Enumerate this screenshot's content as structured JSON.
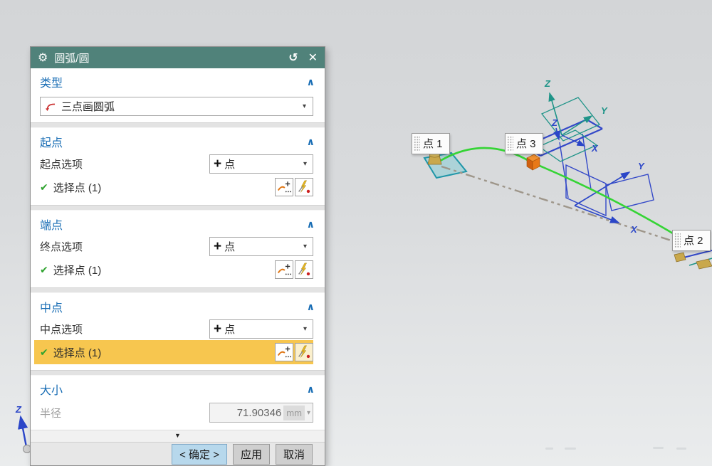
{
  "dialog": {
    "title": "圆弧/圆",
    "type_section": {
      "header": "类型",
      "value": "三点画圆弧"
    },
    "start_section": {
      "header": "起点",
      "option_label": "起点选项",
      "option_value": "点",
      "select_text": "选择点 (1)"
    },
    "end_section": {
      "header": "端点",
      "option_label": "终点选项",
      "option_value": "点",
      "select_text": "选择点 (1)"
    },
    "mid_section": {
      "header": "中点",
      "option_label": "中点选项",
      "option_value": "点",
      "select_text": "选择点 (1)"
    },
    "size_section": {
      "header": "大小",
      "radius_label": "半径",
      "radius_value": "71.90346",
      "radius_unit": "mm"
    },
    "footer": {
      "ok_label": "< 确定 >",
      "apply_label": "应用",
      "cancel_label": "取消"
    }
  },
  "icons": {
    "gear": "⚙",
    "reset": "↺",
    "close": "✕",
    "collapse_chevron": "∧",
    "dropdown_caret": "▾",
    "check": "✔",
    "panel_collapse_arrow": "▼",
    "point_plus": "+"
  },
  "viewport": {
    "point_labels": {
      "p1": "点 1",
      "p2": "点 2",
      "p3": "点 3"
    },
    "axis_labels": {
      "x": "X",
      "y": "Y",
      "z": "Z"
    },
    "colors": {
      "arc_green": "#35d435",
      "chord_gray": "#9e968a",
      "teal_axis": "#1f9488",
      "blue_axis": "#3348c8",
      "highlight_orange": "#f7c64f",
      "titlebar_teal": "#50827a",
      "section_header_blue": "#1a6eb5",
      "ok_button_blue": "#b7d8ec"
    }
  }
}
